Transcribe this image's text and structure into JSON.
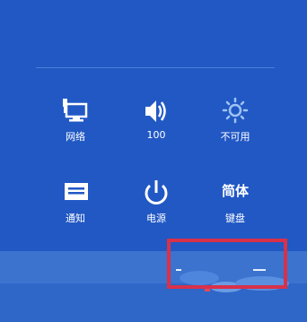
{
  "settings_panel": {
    "tiles": [
      {
        "label": "网络",
        "icon": "network-icon"
      },
      {
        "label": "100",
        "icon": "volume-icon"
      },
      {
        "label": "不可用",
        "icon": "brightness-icon"
      },
      {
        "label": "通知",
        "icon": "notifications-icon"
      },
      {
        "label": "电源",
        "icon": "power-icon"
      },
      {
        "label": "键盘",
        "icon": "keyboard-icon",
        "glyph": "简体"
      }
    ]
  },
  "colors": {
    "background": "#2158c4",
    "bottom_bar": "#3b73cf",
    "highlight": "#d8314a"
  }
}
